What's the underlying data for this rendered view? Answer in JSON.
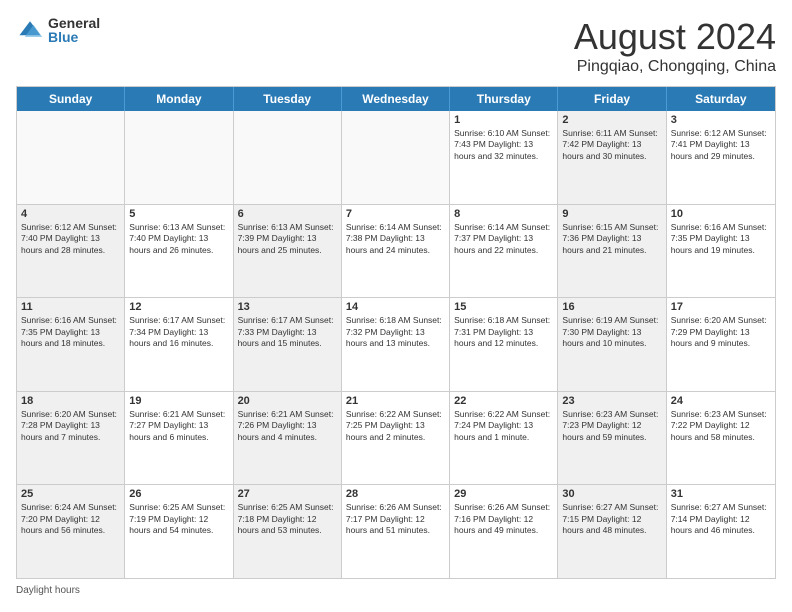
{
  "header": {
    "logo_general": "General",
    "logo_blue": "Blue",
    "month_title": "August 2024",
    "location": "Pingqiao, Chongqing, China"
  },
  "day_headers": [
    "Sunday",
    "Monday",
    "Tuesday",
    "Wednesday",
    "Thursday",
    "Friday",
    "Saturday"
  ],
  "footer": {
    "label": "Daylight hours"
  },
  "rows": [
    {
      "cells": [
        {
          "date": "",
          "info": "",
          "empty": true
        },
        {
          "date": "",
          "info": "",
          "empty": true
        },
        {
          "date": "",
          "info": "",
          "empty": true
        },
        {
          "date": "",
          "info": "",
          "empty": true
        },
        {
          "date": "1",
          "info": "Sunrise: 6:10 AM\nSunset: 7:43 PM\nDaylight: 13 hours\nand 32 minutes.",
          "shaded": false
        },
        {
          "date": "2",
          "info": "Sunrise: 6:11 AM\nSunset: 7:42 PM\nDaylight: 13 hours\nand 30 minutes.",
          "shaded": true
        },
        {
          "date": "3",
          "info": "Sunrise: 6:12 AM\nSunset: 7:41 PM\nDaylight: 13 hours\nand 29 minutes.",
          "shaded": false
        }
      ]
    },
    {
      "cells": [
        {
          "date": "4",
          "info": "Sunrise: 6:12 AM\nSunset: 7:40 PM\nDaylight: 13 hours\nand 28 minutes.",
          "shaded": true
        },
        {
          "date": "5",
          "info": "Sunrise: 6:13 AM\nSunset: 7:40 PM\nDaylight: 13 hours\nand 26 minutes.",
          "shaded": false
        },
        {
          "date": "6",
          "info": "Sunrise: 6:13 AM\nSunset: 7:39 PM\nDaylight: 13 hours\nand 25 minutes.",
          "shaded": true
        },
        {
          "date": "7",
          "info": "Sunrise: 6:14 AM\nSunset: 7:38 PM\nDaylight: 13 hours\nand 24 minutes.",
          "shaded": false
        },
        {
          "date": "8",
          "info": "Sunrise: 6:14 AM\nSunset: 7:37 PM\nDaylight: 13 hours\nand 22 minutes.",
          "shaded": false
        },
        {
          "date": "9",
          "info": "Sunrise: 6:15 AM\nSunset: 7:36 PM\nDaylight: 13 hours\nand 21 minutes.",
          "shaded": true
        },
        {
          "date": "10",
          "info": "Sunrise: 6:16 AM\nSunset: 7:35 PM\nDaylight: 13 hours\nand 19 minutes.",
          "shaded": false
        }
      ]
    },
    {
      "cells": [
        {
          "date": "11",
          "info": "Sunrise: 6:16 AM\nSunset: 7:35 PM\nDaylight: 13 hours\nand 18 minutes.",
          "shaded": true
        },
        {
          "date": "12",
          "info": "Sunrise: 6:17 AM\nSunset: 7:34 PM\nDaylight: 13 hours\nand 16 minutes.",
          "shaded": false
        },
        {
          "date": "13",
          "info": "Sunrise: 6:17 AM\nSunset: 7:33 PM\nDaylight: 13 hours\nand 15 minutes.",
          "shaded": true
        },
        {
          "date": "14",
          "info": "Sunrise: 6:18 AM\nSunset: 7:32 PM\nDaylight: 13 hours\nand 13 minutes.",
          "shaded": false
        },
        {
          "date": "15",
          "info": "Sunrise: 6:18 AM\nSunset: 7:31 PM\nDaylight: 13 hours\nand 12 minutes.",
          "shaded": false
        },
        {
          "date": "16",
          "info": "Sunrise: 6:19 AM\nSunset: 7:30 PM\nDaylight: 13 hours\nand 10 minutes.",
          "shaded": true
        },
        {
          "date": "17",
          "info": "Sunrise: 6:20 AM\nSunset: 7:29 PM\nDaylight: 13 hours\nand 9 minutes.",
          "shaded": false
        }
      ]
    },
    {
      "cells": [
        {
          "date": "18",
          "info": "Sunrise: 6:20 AM\nSunset: 7:28 PM\nDaylight: 13 hours\nand 7 minutes.",
          "shaded": true
        },
        {
          "date": "19",
          "info": "Sunrise: 6:21 AM\nSunset: 7:27 PM\nDaylight: 13 hours\nand 6 minutes.",
          "shaded": false
        },
        {
          "date": "20",
          "info": "Sunrise: 6:21 AM\nSunset: 7:26 PM\nDaylight: 13 hours\nand 4 minutes.",
          "shaded": true
        },
        {
          "date": "21",
          "info": "Sunrise: 6:22 AM\nSunset: 7:25 PM\nDaylight: 13 hours\nand 2 minutes.",
          "shaded": false
        },
        {
          "date": "22",
          "info": "Sunrise: 6:22 AM\nSunset: 7:24 PM\nDaylight: 13 hours\nand 1 minute.",
          "shaded": false
        },
        {
          "date": "23",
          "info": "Sunrise: 6:23 AM\nSunset: 7:23 PM\nDaylight: 12 hours\nand 59 minutes.",
          "shaded": true
        },
        {
          "date": "24",
          "info": "Sunrise: 6:23 AM\nSunset: 7:22 PM\nDaylight: 12 hours\nand 58 minutes.",
          "shaded": false
        }
      ]
    },
    {
      "cells": [
        {
          "date": "25",
          "info": "Sunrise: 6:24 AM\nSunset: 7:20 PM\nDaylight: 12 hours\nand 56 minutes.",
          "shaded": true
        },
        {
          "date": "26",
          "info": "Sunrise: 6:25 AM\nSunset: 7:19 PM\nDaylight: 12 hours\nand 54 minutes.",
          "shaded": false
        },
        {
          "date": "27",
          "info": "Sunrise: 6:25 AM\nSunset: 7:18 PM\nDaylight: 12 hours\nand 53 minutes.",
          "shaded": true
        },
        {
          "date": "28",
          "info": "Sunrise: 6:26 AM\nSunset: 7:17 PM\nDaylight: 12 hours\nand 51 minutes.",
          "shaded": false
        },
        {
          "date": "29",
          "info": "Sunrise: 6:26 AM\nSunset: 7:16 PM\nDaylight: 12 hours\nand 49 minutes.",
          "shaded": false
        },
        {
          "date": "30",
          "info": "Sunrise: 6:27 AM\nSunset: 7:15 PM\nDaylight: 12 hours\nand 48 minutes.",
          "shaded": true
        },
        {
          "date": "31",
          "info": "Sunrise: 6:27 AM\nSunset: 7:14 PM\nDaylight: 12 hours\nand 46 minutes.",
          "shaded": false
        }
      ]
    }
  ]
}
